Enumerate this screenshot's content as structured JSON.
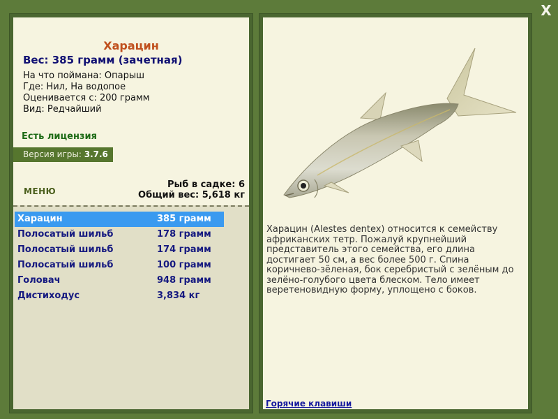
{
  "fish": {
    "name": "Харацин",
    "weight": "Вес: 385 грамм (зачетная)",
    "bait": "На что поймана: Опарыш",
    "location": "Где: Нил, На водопое",
    "rating": "Оценивается с: 200 грамм",
    "rarity": "Вид: Редчайший"
  },
  "license": "Есть лицензия",
  "version": {
    "label": "Версия игры:",
    "value": "3.7.6"
  },
  "menu_label": "МЕНЮ",
  "keep": {
    "count": "Рыб в садке: 6",
    "total": "Общий вес: 5,618 кг"
  },
  "catch_list": [
    {
      "name": "Харацин",
      "weight": "385 грамм",
      "selected": true
    },
    {
      "name": "Полосатый шильб",
      "weight": "178 грамм",
      "selected": false
    },
    {
      "name": "Полосатый шильб",
      "weight": "174 грамм",
      "selected": false
    },
    {
      "name": "Полосатый шильб",
      "weight": "100 грамм",
      "selected": false
    },
    {
      "name": "Головач",
      "weight": "948 грамм",
      "selected": false
    },
    {
      "name": "Дистиходус",
      "weight": "3,834 кг",
      "selected": false
    }
  ],
  "description": "Харацин (Alestes dentex) относится к семейству африканских тетр. Пожалуй крупнейший представитель этого семейства, его длина достигает 50 см, а вес более 500 г. Спина коричнево-зёленая, бок серебристый с зелёным до зелёно-голубого цвета блеском. Тело имеет веретеновидную форму, уплощено с боков.",
  "hotkeys_label": "Горячие клавиши",
  "close_label": "X",
  "icons": {
    "close": "close-icon",
    "fish": "fish-image"
  },
  "colors": {
    "background": "#5d7b3a",
    "panel": "#f6f4e0",
    "list_bg": "#e1dfc7",
    "selection": "#3a9af0",
    "title": "#c0501e",
    "link": "#161a9e"
  }
}
